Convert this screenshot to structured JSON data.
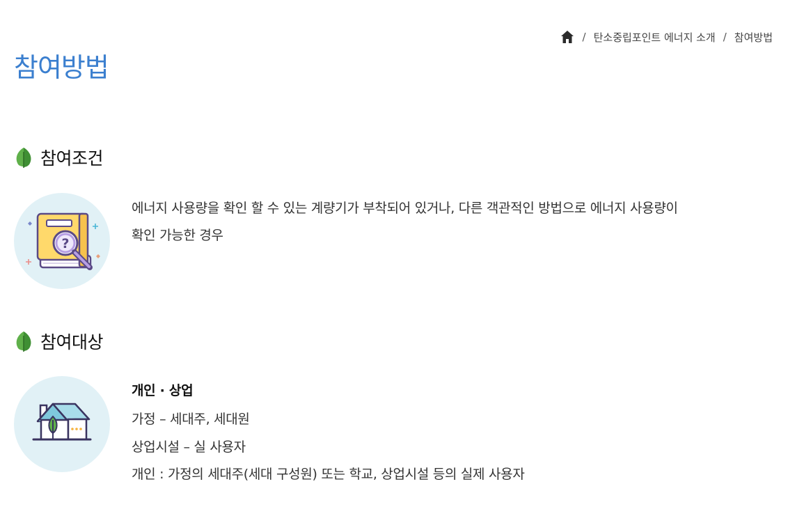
{
  "breadcrumb": {
    "home_icon": "home-icon",
    "separator": "/",
    "items": [
      "탄소중립포인트 에너지 소개",
      "참여방법"
    ]
  },
  "page": {
    "title": "참여방법"
  },
  "sections": [
    {
      "icon": "leaf-icon",
      "title": "참여조건",
      "illustration": "book-magnifier-icon",
      "lines": [
        "에너지 사용량을 확인 할 수 있는 계량기가 부착되어 있거나, 다른 객관적인 방법으로 에너지 사용량이",
        "확인 가능한 경우"
      ]
    },
    {
      "icon": "leaf-icon",
      "title": "참여대상",
      "illustration": "house-leaf-icon",
      "heading": "개인 · 상업",
      "lines": [
        "가정 – 세대주, 세대원",
        "상업시설 – 실 사용자",
        "개인 : 가정의 세대주(세대 구성원) 또는 학교, 상업시설 등의 실제 사용자"
      ]
    }
  ],
  "colors": {
    "title": "#3b7fcf",
    "illustration_bg": "#e1f1f6",
    "leaf_green": "#5fb04a"
  }
}
